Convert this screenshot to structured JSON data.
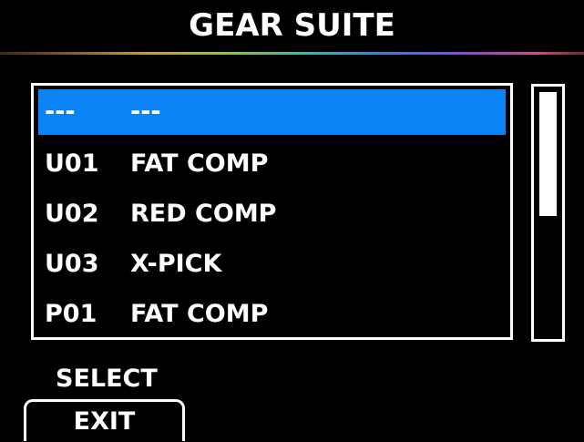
{
  "header": {
    "title": "GEAR SUITE"
  },
  "list": {
    "items": [
      {
        "code": "---",
        "name": "---",
        "selected": true
      },
      {
        "code": "U01",
        "name": "FAT COMP",
        "selected": false
      },
      {
        "code": "U02",
        "name": "RED COMP",
        "selected": false
      },
      {
        "code": "U03",
        "name": "X-PICK",
        "selected": false
      },
      {
        "code": "P01",
        "name": "FAT COMP",
        "selected": false
      }
    ]
  },
  "footer": {
    "select_label": "SELECT",
    "exit_label": "EXIT"
  },
  "colors": {
    "background": "#000000",
    "selection": "#0a84f5",
    "foreground": "#ffffff"
  }
}
